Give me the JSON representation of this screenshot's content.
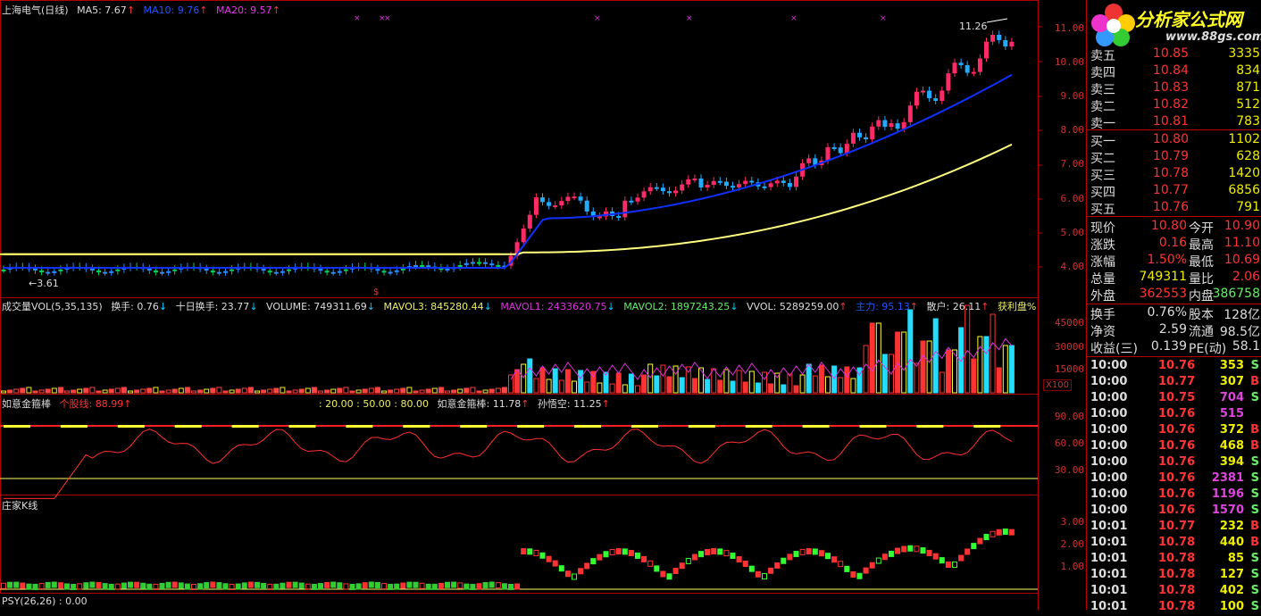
{
  "main": {
    "title": "上海电气(日线)",
    "ma5": "MA5: 7.67",
    "ma10": "MA10: 9.76",
    "ma20": "MA20: 9.57",
    "high_marker": "11.26",
    "low_marker": "3.61",
    "price_ticks": [
      "11.00",
      "10.00",
      "9.00",
      "8.00",
      "7.00",
      "6.00",
      "5.00",
      "4.00"
    ]
  },
  "volume": {
    "title": "成交量VOL(5,35,135)",
    "huanshou": "换手: 0.76",
    "shiri": "十日换手: 23.77",
    "vol": "VOLUME: 749311.69",
    "mavol3": "MAVOL3: 845280.44",
    "mavol1": "MAVOL1: 2433620.75",
    "mavol2": "MAVOL2: 1897243.25",
    "vvol": "VVOL: 5289259.00",
    "zhuli": "主力: 95.13",
    "sanhu": "散户: 26.11",
    "huoli": "获利盘%",
    "ticks": [
      "45000",
      "30000",
      "15000"
    ],
    "unit": "X100"
  },
  "indicator": {
    "title": "如意金箍棒",
    "gegu": "个股线: 88.99",
    "levels": ": 20.00 : 50.00 : 80.00",
    "rjgb": "如意金箍棒: 11.78",
    "swk": "孙悟空: 11.25",
    "ticks": [
      "90.00",
      "60.00",
      "30.00"
    ]
  },
  "zhuang": {
    "title": "庄家K线",
    "ticks": [
      "3.00",
      "2.00",
      "1.00"
    ]
  },
  "psy": {
    "title": "PSY(26,26) : 0.00"
  },
  "logo": {
    "title": "分析家公式网",
    "url": "www.88gs.com"
  },
  "colors": {
    "up": "#ff3333",
    "down": "#00e0ff",
    "ma": "#ffff66",
    "blue": "#1030ff",
    "axis": "#b00000"
  },
  "sell": [
    {
      "label": "卖五",
      "price": "10.85",
      "vol": "3335"
    },
    {
      "label": "卖四",
      "price": "10.84",
      "vol": "834"
    },
    {
      "label": "卖三",
      "price": "10.83",
      "vol": "871"
    },
    {
      "label": "卖二",
      "price": "10.82",
      "vol": "512"
    },
    {
      "label": "卖一",
      "price": "10.81",
      "vol": "783"
    }
  ],
  "buy": [
    {
      "label": "买一",
      "price": "10.80",
      "vol": "1102"
    },
    {
      "label": "买二",
      "price": "10.79",
      "vol": "628"
    },
    {
      "label": "买三",
      "price": "10.78",
      "vol": "1420"
    },
    {
      "label": "买四",
      "price": "10.77",
      "vol": "6856"
    },
    {
      "label": "买五",
      "price": "10.76",
      "vol": "791"
    }
  ],
  "quote": [
    {
      "l1": "现价",
      "v1": "10.80",
      "l2": "今开",
      "v2": "10.90"
    },
    {
      "l1": "涨跌",
      "v1": "0.16",
      "l2": "最高",
      "v2": "11.10"
    },
    {
      "l1": "涨幅",
      "v1": "1.50%",
      "l2": "最低",
      "v2": "10.69"
    },
    {
      "l1": "总量",
      "v1": "749311",
      "l2": "量比",
      "v2": "2.06"
    },
    {
      "l1": "外盘",
      "v1": "362553",
      "l2": "内盘",
      "v2": "386758"
    }
  ],
  "stats": [
    {
      "l1": "换手",
      "v1": "0.76%",
      "l2": "股本",
      "v2": "128亿"
    },
    {
      "l1": "净资",
      "v1": "2.59",
      "l2": "流通",
      "v2": "98.5亿"
    },
    {
      "l1": "收益(三)",
      "v1": "0.139",
      "l2": "PE(动)",
      "v2": "58.1"
    }
  ],
  "ticks": [
    {
      "time": "10:00",
      "price": "10.76",
      "vol": "353",
      "side": "S"
    },
    {
      "time": "10:00",
      "price": "10.77",
      "vol": "307",
      "side": "B"
    },
    {
      "time": "10:00",
      "price": "10.75",
      "vol": "704",
      "side": "S"
    },
    {
      "time": "10:00",
      "price": "10.76",
      "vol": "515",
      "side": ""
    },
    {
      "time": "10:00",
      "price": "10.76",
      "vol": "372",
      "side": "B"
    },
    {
      "time": "10:00",
      "price": "10.76",
      "vol": "468",
      "side": "B"
    },
    {
      "time": "10:00",
      "price": "10.76",
      "vol": "394",
      "side": "S"
    },
    {
      "time": "10:00",
      "price": "10.76",
      "vol": "2381",
      "side": "S"
    },
    {
      "time": "10:00",
      "price": "10.76",
      "vol": "1196",
      "side": "S"
    },
    {
      "time": "10:00",
      "price": "10.76",
      "vol": "1570",
      "side": "S"
    },
    {
      "time": "10:01",
      "price": "10.77",
      "vol": "232",
      "side": "B"
    },
    {
      "time": "10:01",
      "price": "10.78",
      "vol": "440",
      "side": "B"
    },
    {
      "time": "10:01",
      "price": "10.78",
      "vol": "85",
      "side": "S"
    },
    {
      "time": "10:01",
      "price": "10.78",
      "vol": "127",
      "side": "S"
    },
    {
      "time": "10:01",
      "price": "10.78",
      "vol": "402",
      "side": "S"
    },
    {
      "time": "10:01",
      "price": "10.78",
      "vol": "100",
      "side": "S"
    }
  ]
}
